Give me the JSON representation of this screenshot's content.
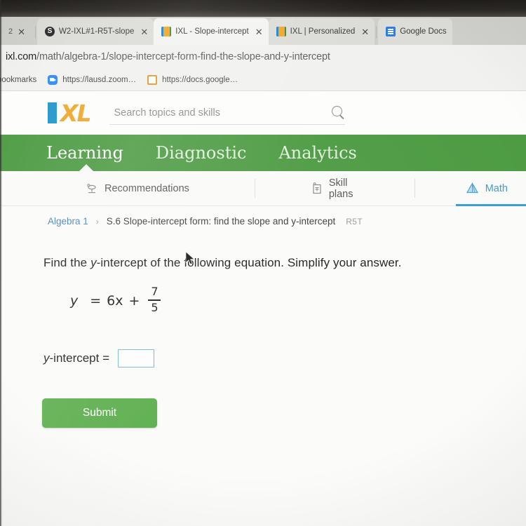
{
  "browser": {
    "tab_partial": {
      "label": "2",
      "close_icon": "close-icon"
    },
    "tabs": [
      {
        "favicon": "schoology-icon",
        "favicon_letter": "S",
        "title": "W2-IXL#1-R5T-slope",
        "close": "✕",
        "state": "inactive"
      },
      {
        "favicon": "ixl-icon",
        "favicon_letter": "",
        "title": "IXL - Slope-intercept",
        "close": "✕",
        "state": "active"
      },
      {
        "favicon": "ixl-icon",
        "favicon_letter": "",
        "title": "IXL | Personalized",
        "close": "✕",
        "state": "inactive"
      },
      {
        "favicon": "google-docs-icon",
        "favicon_letter": "",
        "title": "Google Docs",
        "close": "",
        "state": "inactive"
      }
    ],
    "url": {
      "domain": "ixl.com",
      "path": "/math/algebra-1/slope-intercept-form-find-the-slope-and-y-intercept"
    },
    "bookmarks_label": "bookmarks",
    "bookmarks": [
      {
        "icon": "zoom-icon",
        "label": "https://lausd.zoom…"
      },
      {
        "icon": "google-docs-bookmark-icon",
        "label": "https://docs.google…"
      }
    ]
  },
  "site": {
    "logo": {
      "text": "XL",
      "bar_color": "#2196c9",
      "text_color": "#f0a72c"
    },
    "search": {
      "placeholder": "Search topics and skills",
      "value": "",
      "icon": "search-icon"
    },
    "primary_nav": [
      {
        "label": "Learning",
        "active": true
      },
      {
        "label": "Diagnostic",
        "active": false
      },
      {
        "label": "Analytics",
        "active": false
      }
    ],
    "primary_nav_bg": "#4d9b43",
    "sub_nav": [
      {
        "label": "Recommendations",
        "icon": "recommendations-icon",
        "active": false
      },
      {
        "label": "Skill plans",
        "icon": "skill-plans-icon",
        "active": false
      },
      {
        "label": "Math",
        "icon": "math-pyramid-icon",
        "active": true
      }
    ],
    "accent_color": "#3e9bd4"
  },
  "breadcrumb": {
    "course": "Algebra 1",
    "separator": "›",
    "skill": "S.6 Slope-intercept form: find the slope and y-intercept",
    "skill_code": "R5T"
  },
  "problem": {
    "prompt_part1": "Find the ",
    "prompt_y": "y",
    "prompt_part2": "-intercept of the following equation. Simplify your answer.",
    "equation": {
      "lhs": "y",
      "equals": "=",
      "term": "6x",
      "plus": "+",
      "fraction": {
        "numerator": "7",
        "denominator": "5"
      }
    },
    "answer_label_y": "y",
    "answer_label_rest": "-intercept =",
    "answer_value": "",
    "submit_label": "Submit"
  }
}
